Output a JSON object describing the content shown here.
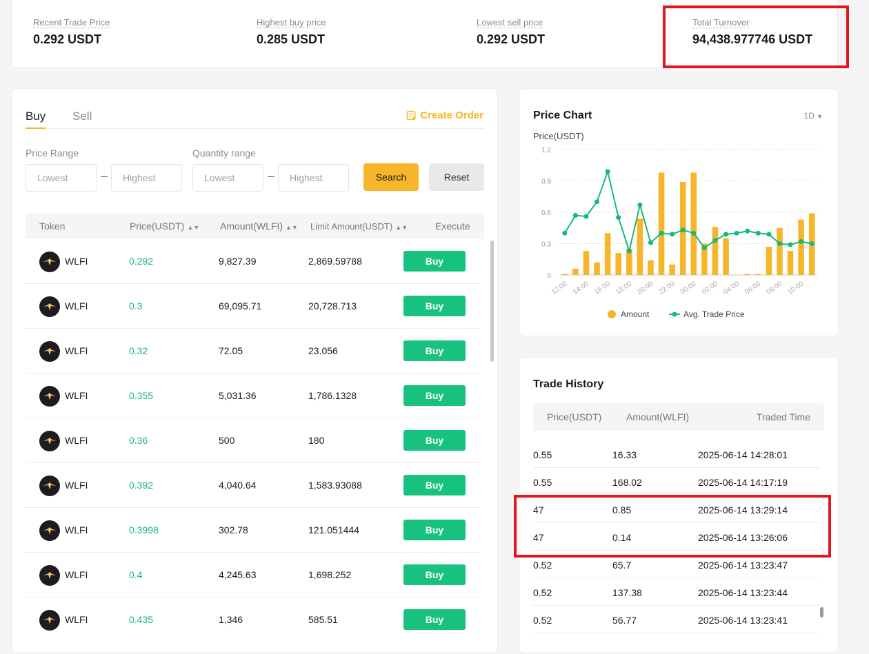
{
  "stats": {
    "recent_label": "Recent Trade Price",
    "recent_value": "0.292 USDT",
    "highest_buy_label": "Highest buy price",
    "highest_buy_value": "0.285 USDT",
    "lowest_sell_label": "Lowest sell price",
    "lowest_sell_value": "0.292 USDT",
    "turnover_label": "Total Turnover",
    "turnover_value": "94,438.977746 USDT"
  },
  "orders": {
    "tabs": [
      "Buy",
      "Sell"
    ],
    "active_tab": "Buy",
    "create_order_label": "Create Order",
    "price_range_label": "Price Range",
    "quantity_range_label": "Quantity range",
    "price_lowest_placeholder": "Lowest",
    "price_highest_placeholder": "Highest",
    "qty_lowest_placeholder": "Lowest",
    "qty_highest_placeholder": "Highest",
    "search_label": "Search",
    "reset_label": "Reset",
    "columns": {
      "token": "Token",
      "price": "Price(USDT)",
      "amount": "Amount(WLFI)",
      "limit": "Limit Amount(USDT)",
      "execute": "Execute"
    },
    "rows": [
      {
        "token": "WLFI",
        "price": "0.292",
        "amount": "9,827.39",
        "limit": "2,869.59788",
        "action": "Buy"
      },
      {
        "token": "WLFI",
        "price": "0.3",
        "amount": "69,095.71",
        "limit": "20,728.713",
        "action": "Buy"
      },
      {
        "token": "WLFI",
        "price": "0.32",
        "amount": "72.05",
        "limit": "23.056",
        "action": "Buy"
      },
      {
        "token": "WLFI",
        "price": "0.355",
        "amount": "5,031.36",
        "limit": "1,786.1328",
        "action": "Buy"
      },
      {
        "token": "WLFI",
        "price": "0.36",
        "amount": "500",
        "limit": "180",
        "action": "Buy"
      },
      {
        "token": "WLFI",
        "price": "0.392",
        "amount": "4,040.64",
        "limit": "1,583.93088",
        "action": "Buy"
      },
      {
        "token": "WLFI",
        "price": "0.3998",
        "amount": "302.78",
        "limit": "121.051444",
        "action": "Buy"
      },
      {
        "token": "WLFI",
        "price": "0.4",
        "amount": "4,245.63",
        "limit": "1,698.252",
        "action": "Buy"
      },
      {
        "token": "WLFI",
        "price": "0.435",
        "amount": "1,346",
        "limit": "585.51",
        "action": "Buy"
      }
    ]
  },
  "price_chart": {
    "title": "Price Chart",
    "range": "1D",
    "y_label": "Price(USDT)"
  },
  "chart_data": {
    "type": "bar",
    "ylabel": "Price(USDT)",
    "ylim": [
      0,
      1.2
    ],
    "yticks": [
      "0",
      "0.3",
      "0.6",
      "0.9",
      "1.2"
    ],
    "x_tick_labels": [
      "12:00",
      "14:00",
      "16:00",
      "18:00",
      "20:00",
      "22:00",
      "00:00",
      "02:00",
      "04:00",
      "06:00",
      "08:00",
      "10:00"
    ],
    "categories": [
      "12:00",
      "13:00",
      "14:00",
      "15:00",
      "16:00",
      "17:00",
      "18:00",
      "19:00",
      "20:00",
      "21:00",
      "22:00",
      "23:00",
      "00:00",
      "01:00",
      "02:00",
      "03:00",
      "04:00",
      "05:00",
      "06:00",
      "07:00",
      "08:00",
      "09:00",
      "10:00",
      "11:00"
    ],
    "grid": true,
    "legend_position": "bottom",
    "series": [
      {
        "name": "Amount",
        "type": "bar",
        "color": "#f7b529",
        "values": [
          0.01,
          0.06,
          0.23,
          0.12,
          0.4,
          0.21,
          0.25,
          0.54,
          0.14,
          0.98,
          0.1,
          0.89,
          0.98,
          0.3,
          0.46,
          0.35,
          0.0,
          0.01,
          0.01,
          0.27,
          0.45,
          0.23,
          0.53,
          0.59
        ]
      },
      {
        "name": "Avg. Trade Price",
        "type": "line",
        "color": "#17b978",
        "values": [
          0.4,
          0.57,
          0.56,
          0.7,
          0.99,
          0.55,
          0.23,
          0.67,
          0.31,
          0.4,
          0.39,
          0.43,
          0.4,
          0.26,
          0.33,
          0.39,
          0.4,
          0.42,
          0.4,
          0.39,
          0.3,
          0.29,
          0.32,
          0.3
        ]
      }
    ]
  },
  "history": {
    "title": "Trade History",
    "columns": {
      "price": "Price(USDT)",
      "amount": "Amount(WLFI)",
      "time": "Traded Time"
    },
    "rows": [
      {
        "price": "0.55",
        "amount": "16.33",
        "time": "2025-06-14 14:28:01"
      },
      {
        "price": "0.55",
        "amount": "168.02",
        "time": "2025-06-14 14:17:19"
      },
      {
        "price": "47",
        "amount": "0.85",
        "time": "2025-06-14 13:29:14"
      },
      {
        "price": "47",
        "amount": "0.14",
        "time": "2025-06-14 13:26:06"
      },
      {
        "price": "0.52",
        "amount": "65.7",
        "time": "2025-06-14 13:23:47"
      },
      {
        "price": "0.52",
        "amount": "137.38",
        "time": "2025-06-14 13:23:44"
      },
      {
        "price": "0.52",
        "amount": "56.77",
        "time": "2025-06-14 13:23:41"
      }
    ]
  },
  "colors": {
    "accent": "#f7b529",
    "buy_green": "#17c27e",
    "price_green": "#17b978",
    "highlight_red": "#e5141f"
  }
}
